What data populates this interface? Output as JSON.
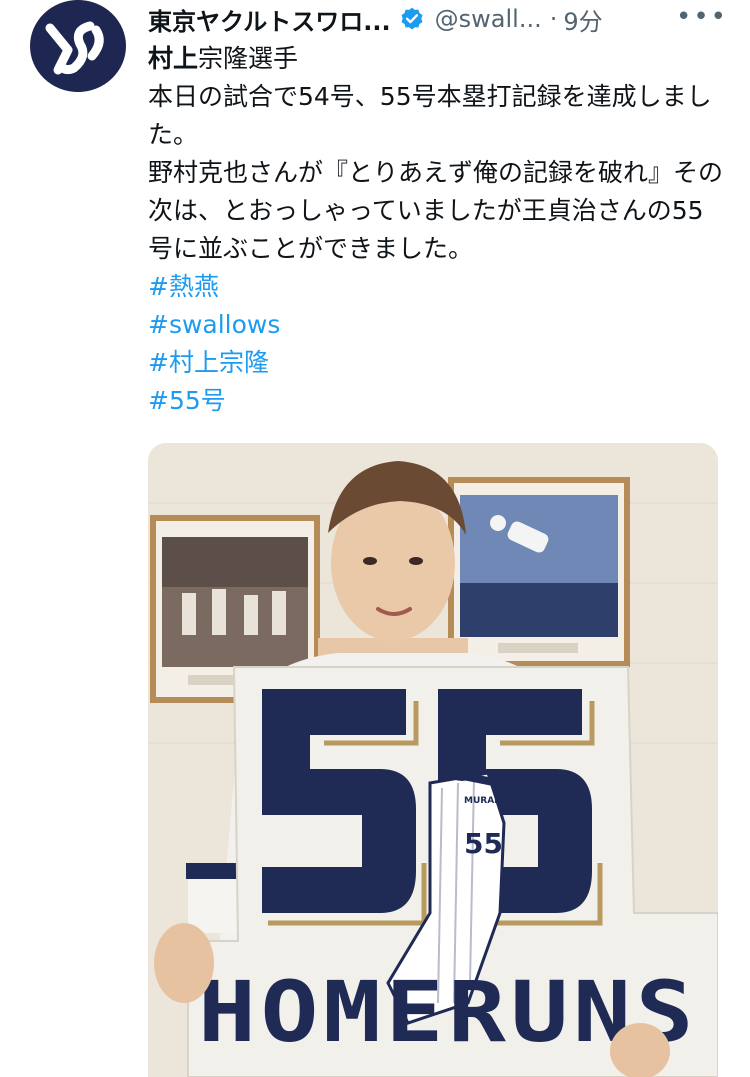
{
  "account": {
    "display_name": "東京ヤクルトスワロ...",
    "handle": "@swall...",
    "separator": "·",
    "time": "9分",
    "more_icon": "more-icon",
    "verified_icon": "verified-badge-icon",
    "avatar_logo": "YS"
  },
  "tweet": {
    "line1_bold": "村上",
    "line1_rest": "宗隆選手",
    "line2": "本日の試合で54号、55号本塁打記録を達成しました。",
    "line3": "野村克也さんが『とりあえず俺の記録を破れ』その次は、とおっしゃっていましたが王貞治さんの55号に並ぶことができました。",
    "hashtags": [
      "#熱燕",
      "#swallows",
      "#村上宗隆",
      "#55号"
    ]
  },
  "media": {
    "board_number": "55",
    "board_caption": "HOMERUNS",
    "jersey_name": "MURAKAMI",
    "jersey_number": "55",
    "colors": {
      "navy": "#1f2a55",
      "gold": "#b89a5e",
      "wall": "#ece6da"
    }
  }
}
